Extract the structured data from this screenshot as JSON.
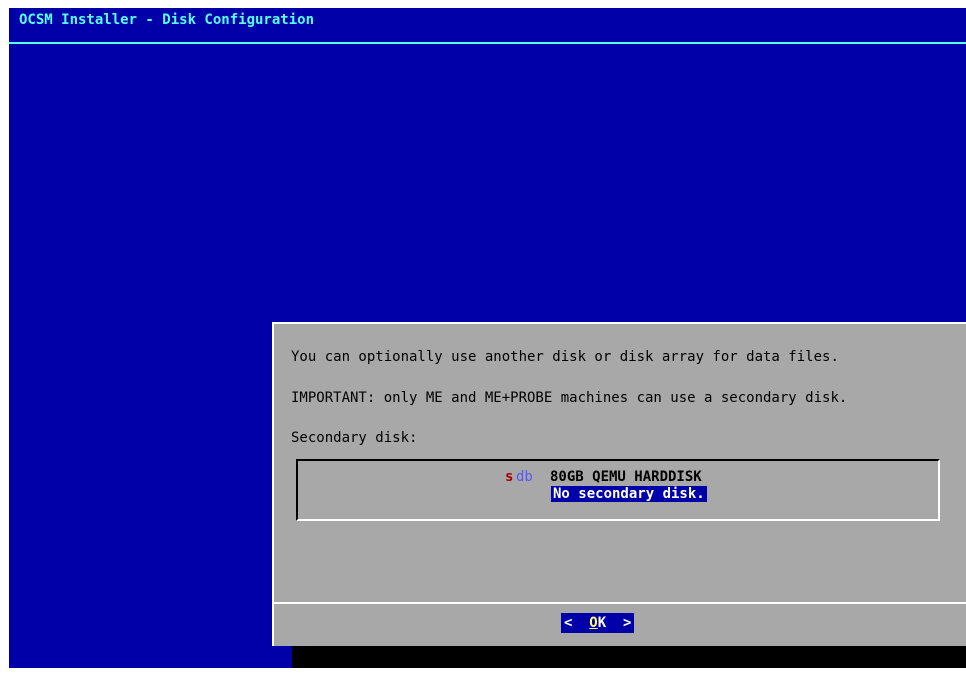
{
  "window": {
    "title": "OCSM Installer - Disk Configuration"
  },
  "dialog": {
    "line1": "You can optionally use another disk or disk array for data files.",
    "line2": "IMPORTANT: only ME and ME+PROBE machines can use a secondary disk.",
    "line3": "Secondary disk:"
  },
  "disk_list": {
    "options": [
      {
        "device_s": "s",
        "device_db": "db",
        "label": "80GB QEMU HARDDISK",
        "selected": false
      },
      {
        "label": "No secondary disk.",
        "selected": true
      }
    ]
  },
  "buttons": {
    "ok_left": "<",
    "ok_hotkey": "O",
    "ok_rest": "K",
    "ok_right": ">"
  },
  "colors": {
    "background": "#0000a8",
    "title": "#55ffff",
    "dialog": "#a8a8a8",
    "selection": "#0000a8",
    "device_s": "#a80000",
    "device_db": "#5555ff"
  }
}
